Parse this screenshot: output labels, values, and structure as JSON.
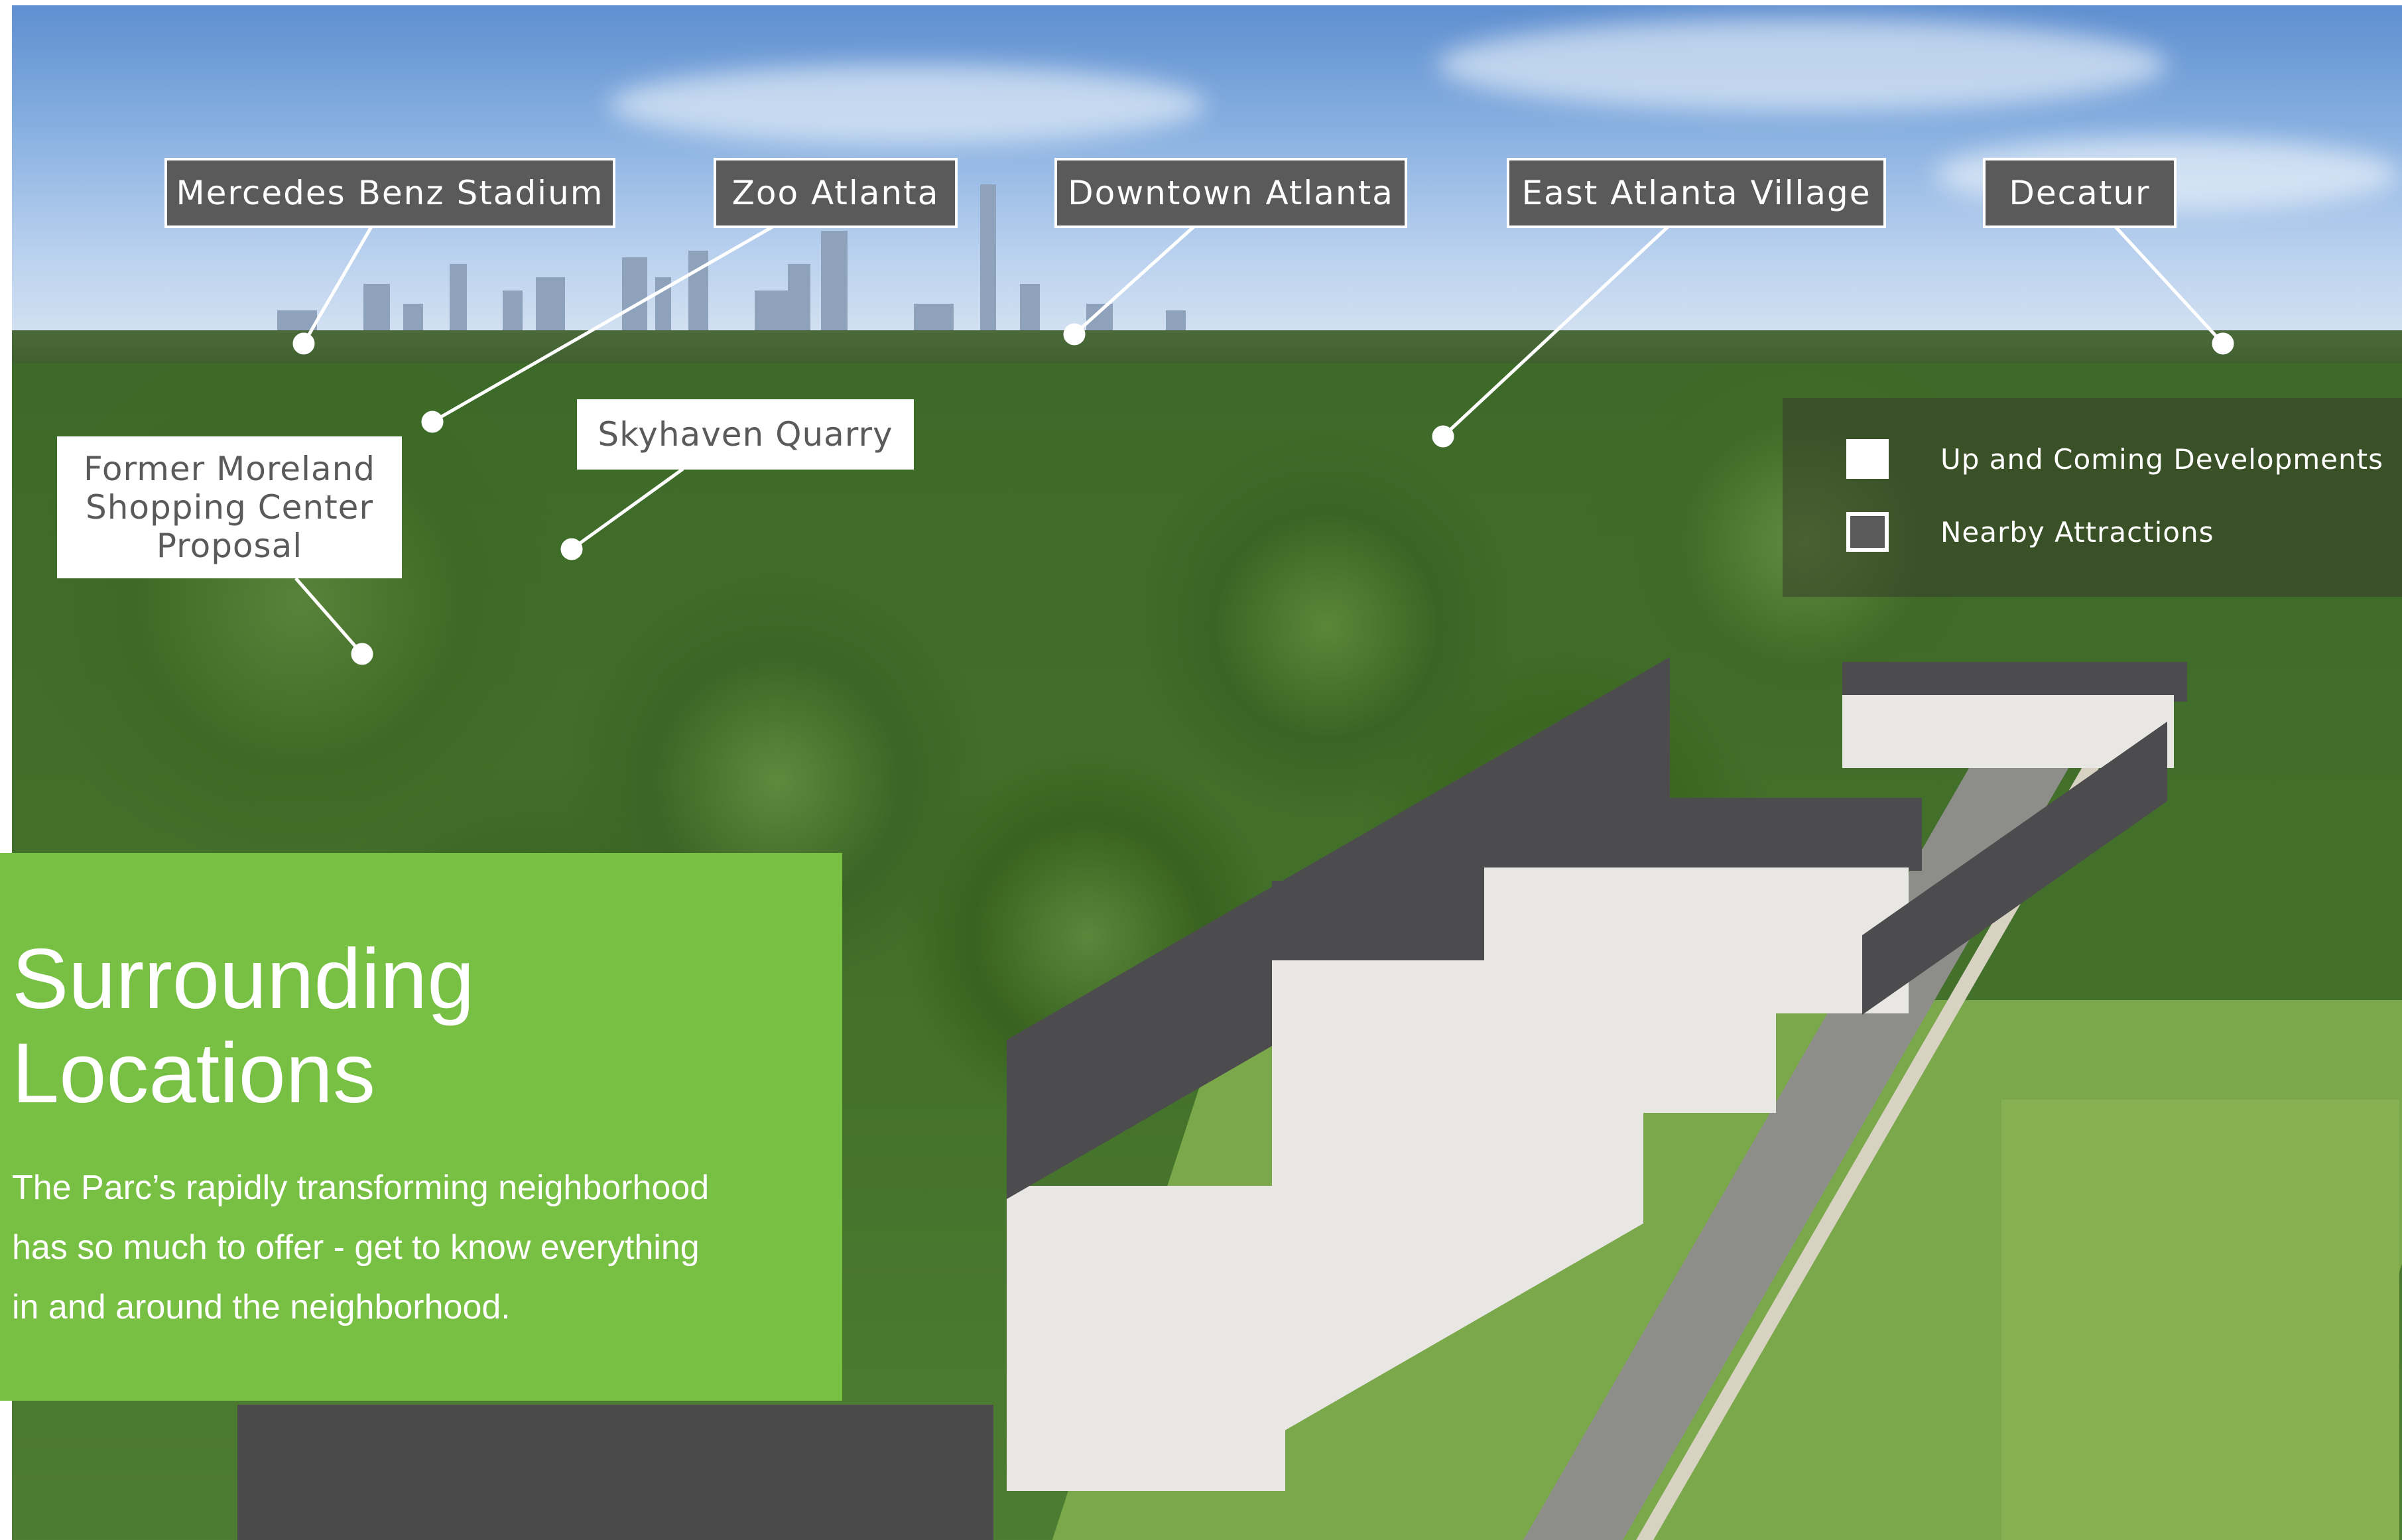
{
  "callouts": [
    {
      "id": "mercedes-benz-stadium",
      "text": "Mercedes Benz Stadium",
      "category": "Nearby Attractions"
    },
    {
      "id": "zoo-atlanta",
      "text": "Zoo Atlanta",
      "category": "Nearby Attractions"
    },
    {
      "id": "downtown-atlanta",
      "text": "Downtown Atlanta",
      "category": "Nearby Attractions"
    },
    {
      "id": "east-atlanta-village",
      "text": "East Atlanta Village",
      "category": "Nearby Attractions"
    },
    {
      "id": "decatur",
      "text": "Decatur",
      "category": "Nearby Attractions"
    },
    {
      "id": "skyhaven-quarry",
      "text": "Skyhaven Quarry",
      "category": "Up and Coming Developments"
    },
    {
      "id": "former-moreland",
      "lines": [
        "Former Moreland",
        "Shopping Center",
        "Proposal"
      ],
      "category": "Up and Coming Developments"
    }
  ],
  "legend": {
    "items": [
      {
        "label": "Up and Coming Developments",
        "swatch": "white"
      },
      {
        "label": "Nearby Attractions",
        "swatch": "gray"
      }
    ]
  },
  "panel": {
    "title_lines": [
      "Surrounding",
      "Locations"
    ],
    "body_lines": [
      "The Parc’s rapidly transforming neighborhood",
      "has so much to offer - get to know everything",
      "in and around the neighborhood."
    ]
  },
  "colors": {
    "panel_green": "#78c044",
    "label_dark": "#5a5a5a",
    "label_light": "#ffffff"
  }
}
